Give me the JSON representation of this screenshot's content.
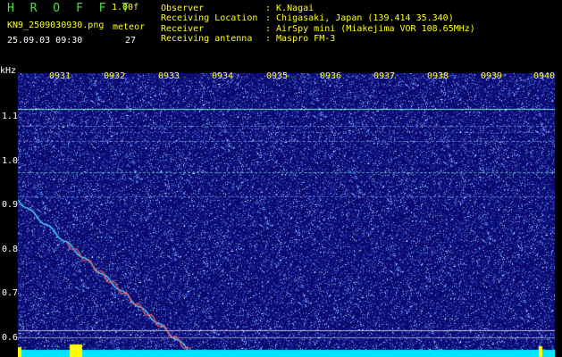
{
  "header": {
    "logo": "H R O F F T",
    "version": "1.00f",
    "filename": "KN9_2509030930.png",
    "meteor_label": "meteor",
    "datetime": "25.09.03 09:30",
    "meteor_count": "27"
  },
  "info": [
    {
      "label": "Observer",
      "value": ": K.Nagai"
    },
    {
      "label": "Receiving Location",
      "value": ": Chigasaki, Japan (139.414 35.340)"
    },
    {
      "label": "Receiver",
      "value": ": AirSpy mini (Miakejima VOR 108.65MHz)"
    },
    {
      "label": "Receiving antenna",
      "value": ": Maspro FM-3"
    }
  ],
  "axis": {
    "y_unit": "kHz",
    "y_ticks": [
      "1.1",
      "1.0",
      "0.9",
      "0.8",
      "0.7",
      "0.6"
    ],
    "time_ticks": [
      "0931",
      "0932",
      "0933",
      "0934",
      "0935",
      "0936",
      "0937",
      "0938",
      "0939",
      "0940"
    ]
  },
  "colors": {
    "background": "#000000",
    "plot_background": "#0b0a6e",
    "noise_light": "#8fb8ff",
    "carrier_line": "#7fffd4",
    "meteor_trail": "#ff5a5a",
    "text_green": "#49e23a",
    "text_yellow": "#ffff1a",
    "baseline_cyan": "#00e5ff",
    "yellow_burst": "#ffff00"
  }
}
